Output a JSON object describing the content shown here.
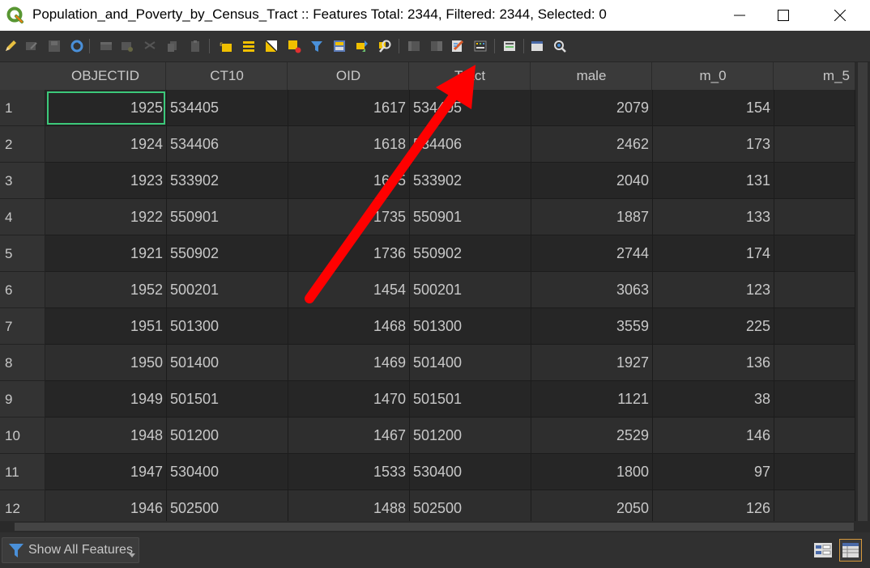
{
  "window": {
    "title": "Population_and_Poverty_by_Census_Tract :: Features Total: 2344, Filtered: 2344, Selected: 0"
  },
  "toolbar": {
    "icons": [
      "pencil-icon",
      "multi-edit-icon",
      "save-icon",
      "reload-icon",
      "add-feature-icon",
      "delete-feature-icon",
      "cut-icon",
      "copy-icon",
      "paste-icon",
      "select-by-expression-icon",
      "select-all-icon",
      "invert-selection-icon",
      "deselect-all-icon",
      "filter-icon",
      "move-selection-to-top-icon",
      "pan-to-selected-icon",
      "zoom-to-selected-icon",
      "new-field-icon",
      "delete-field-icon",
      "conditional-formatting-icon",
      "field-calculator-icon",
      "actions-icon",
      "dock-icon",
      "organize-columns-icon"
    ]
  },
  "table": {
    "columns": [
      "OBJECTID",
      "CT10",
      "OID",
      "Tract",
      "male",
      "m_0",
      "m_5"
    ],
    "rows": [
      {
        "num": "1",
        "cells": [
          "1925",
          "534405",
          "1617",
          "534405",
          "2079",
          "154",
          ""
        ]
      },
      {
        "num": "2",
        "cells": [
          "1924",
          "534406",
          "1618",
          "534406",
          "2462",
          "173",
          ""
        ]
      },
      {
        "num": "3",
        "cells": [
          "1923",
          "533902",
          "1605",
          "533902",
          "2040",
          "131",
          ""
        ]
      },
      {
        "num": "4",
        "cells": [
          "1922",
          "550901",
          "1735",
          "550901",
          "1887",
          "133",
          ""
        ]
      },
      {
        "num": "5",
        "cells": [
          "1921",
          "550902",
          "1736",
          "550902",
          "2744",
          "174",
          ""
        ]
      },
      {
        "num": "6",
        "cells": [
          "1952",
          "500201",
          "1454",
          "500201",
          "3063",
          "123",
          ""
        ]
      },
      {
        "num": "7",
        "cells": [
          "1951",
          "501300",
          "1468",
          "501300",
          "3559",
          "225",
          ""
        ]
      },
      {
        "num": "8",
        "cells": [
          "1950",
          "501400",
          "1469",
          "501400",
          "1927",
          "136",
          ""
        ]
      },
      {
        "num": "9",
        "cells": [
          "1949",
          "501501",
          "1470",
          "501501",
          "1121",
          "38",
          ""
        ]
      },
      {
        "num": "10",
        "cells": [
          "1948",
          "501200",
          "1467",
          "501200",
          "2529",
          "146",
          ""
        ]
      },
      {
        "num": "11",
        "cells": [
          "1947",
          "530400",
          "1533",
          "530400",
          "1800",
          "97",
          ""
        ]
      },
      {
        "num": "12",
        "cells": [
          "1946",
          "502500",
          "1488",
          "502500",
          "2050",
          "126",
          ""
        ]
      }
    ],
    "selected_cell": {
      "row": 0,
      "col": 0
    }
  },
  "bottom": {
    "show_all_label": "Show All Features"
  },
  "colors": {
    "selection_outline": "#3cc87a",
    "arrow": "#ff0000"
  }
}
